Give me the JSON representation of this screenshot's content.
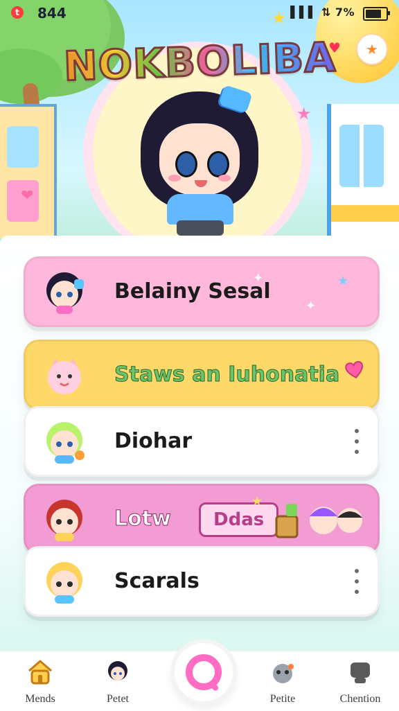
{
  "status_bar": {
    "time": "844",
    "record_badge": "t",
    "signal_text": "▌▌▌ ⇅ 7%"
  },
  "header": {
    "title": "NOKBOLIBA"
  },
  "list": {
    "items": [
      {
        "label": "Belainy Sesal"
      },
      {
        "label": "Staws an Iuhonatia"
      },
      {
        "label": "Diohar"
      },
      {
        "label": "Lotw",
        "tag": "Ddas"
      },
      {
        "label": "Scarals"
      }
    ]
  },
  "bottom_nav": {
    "items": [
      {
        "label": "Mends"
      },
      {
        "label": "Petet"
      },
      {
        "label": "Petite"
      },
      {
        "label": "Chention"
      }
    ]
  },
  "colors": {
    "pink_card": "#ffb8dc",
    "yellow_card": "#ffd86a",
    "white_card": "#ffffff",
    "magenta_card": "#f39bd3",
    "accent_pink": "#ff6cc4"
  },
  "icons": {
    "top_right_1": "heart-icon",
    "top_right_2": "star-icon",
    "center_nav": "search-icon",
    "more": "more-vertical-icon"
  }
}
